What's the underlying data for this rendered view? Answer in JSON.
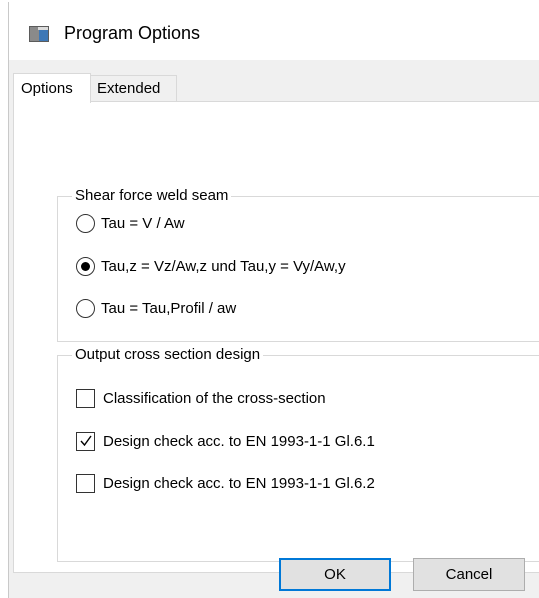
{
  "window": {
    "title": "Program Options",
    "app_icon": "program-options-icon"
  },
  "tabs": [
    {
      "label": "Options",
      "active": true
    },
    {
      "label": "Extended",
      "active": false
    }
  ],
  "shear_group": {
    "legend": "Shear force weld seam",
    "options": [
      {
        "label": "Tau = V / Aw",
        "checked": false
      },
      {
        "label": "Tau,z = Vz/Aw,z  und Tau,y = Vy/Aw,y",
        "checked": true
      },
      {
        "label": "Tau = Tau,Profil / aw",
        "checked": false
      }
    ]
  },
  "output_group": {
    "legend": "Output cross section design",
    "options": [
      {
        "label": "Classification of the cross-section",
        "checked": false
      },
      {
        "label": "Design check acc. to EN 1993-1-1 Gl.6.1",
        "checked": true
      },
      {
        "label": "Design check acc. to EN 1993-1-1 Gl.6.2",
        "checked": false
      }
    ]
  },
  "buttons": {
    "ok": "OK",
    "cancel": "Cancel"
  },
  "colors": {
    "accent": "#0078d7",
    "panel_bg": "#ffffff",
    "client_bg": "#f0f0f0",
    "border": "#d9d9d9"
  }
}
